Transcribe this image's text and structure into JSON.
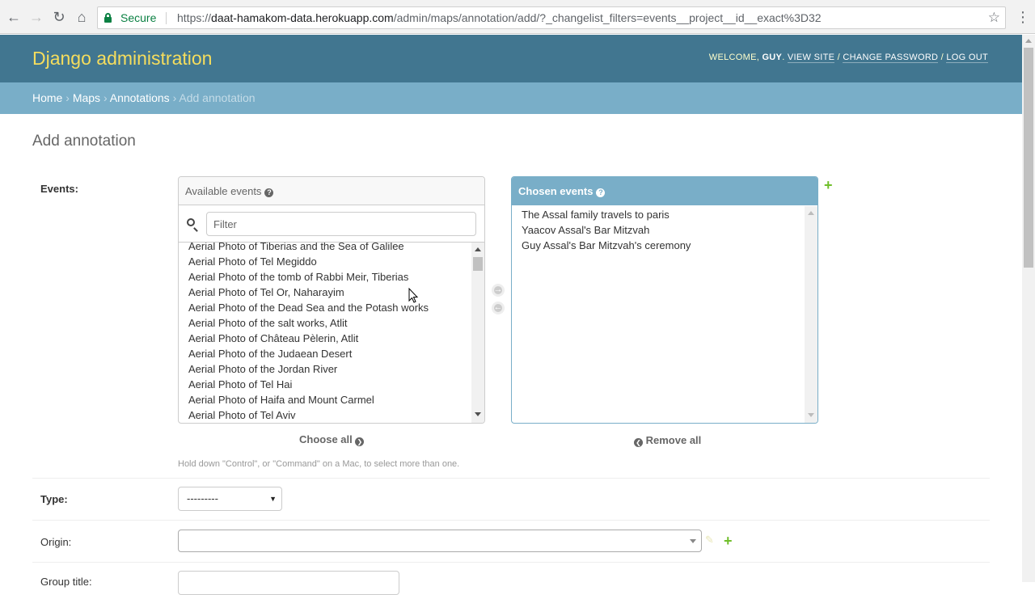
{
  "browser": {
    "secure_label": "Secure",
    "url_scheme": "https://",
    "url_host": "daat-hamakom-data.herokuapp.com",
    "url_path": "/admin/maps/annotation/add/?_changelist_filters=events__project__id__exact%3D32"
  },
  "header": {
    "branding": "Django administration",
    "welcome": "Welcome,",
    "user": "Guy",
    "view_site": "View site",
    "change_password": "Change password",
    "log_out": "Log out"
  },
  "breadcrumbs": {
    "home": "Home",
    "maps": "Maps",
    "annotations": "Annotations",
    "current": "Add annotation",
    "sep": "›"
  },
  "page_title": "Add annotation",
  "events": {
    "label": "Events:",
    "available_title": "Available events",
    "filter_placeholder": "Filter",
    "available": [
      "Aerial Photo of Tiberias and the Sea of Galilee",
      "Aerial Photo of Tel Megiddo",
      "Aerial Photo of the tomb of Rabbi Meir, Tiberias",
      "Aerial Photo of Tel Or, Naharayim",
      "Aerial Photo of the Dead Sea and the Potash works",
      "Aerial Photo of the salt works, Atlit",
      "Aerial Photo of Château Pèlerin, Atlit",
      "Aerial Photo of the Judaean Desert",
      "Aerial Photo of the Jordan River",
      "Aerial Photo of Tel Hai",
      "Aerial Photo of Haifa and Mount Carmel",
      "Aerial Photo of Tel Aviv"
    ],
    "chosen_title": "Chosen events",
    "chosen": [
      "The Assal family travels to paris",
      "Yaacov Assal's Bar Mitzvah",
      "Guy Assal's Bar Mitzvah's ceremony"
    ],
    "choose_all": "Choose all",
    "remove_all": "Remove all",
    "help_text": "Hold down \"Control\", or \"Command\" on a Mac, to select more than one."
  },
  "type": {
    "label": "Type:",
    "value": "---------"
  },
  "origin": {
    "label": "Origin:"
  },
  "group_title": {
    "label": "Group title:"
  },
  "colors": {
    "header_bg": "#417690",
    "breadcrumbs_bg": "#79aec8",
    "branding": "#f5dd5d",
    "add_green": "#70bf2b"
  },
  "icons": {
    "back": "arrow-left-icon",
    "forward": "arrow-right-icon",
    "reload": "reload-icon",
    "home": "home-icon",
    "bookmark": "star-icon",
    "menu": "kebab-menu-icon",
    "search": "search-icon",
    "help": "question-circle-icon",
    "add": "plus-icon",
    "edit": "pencil-icon"
  }
}
